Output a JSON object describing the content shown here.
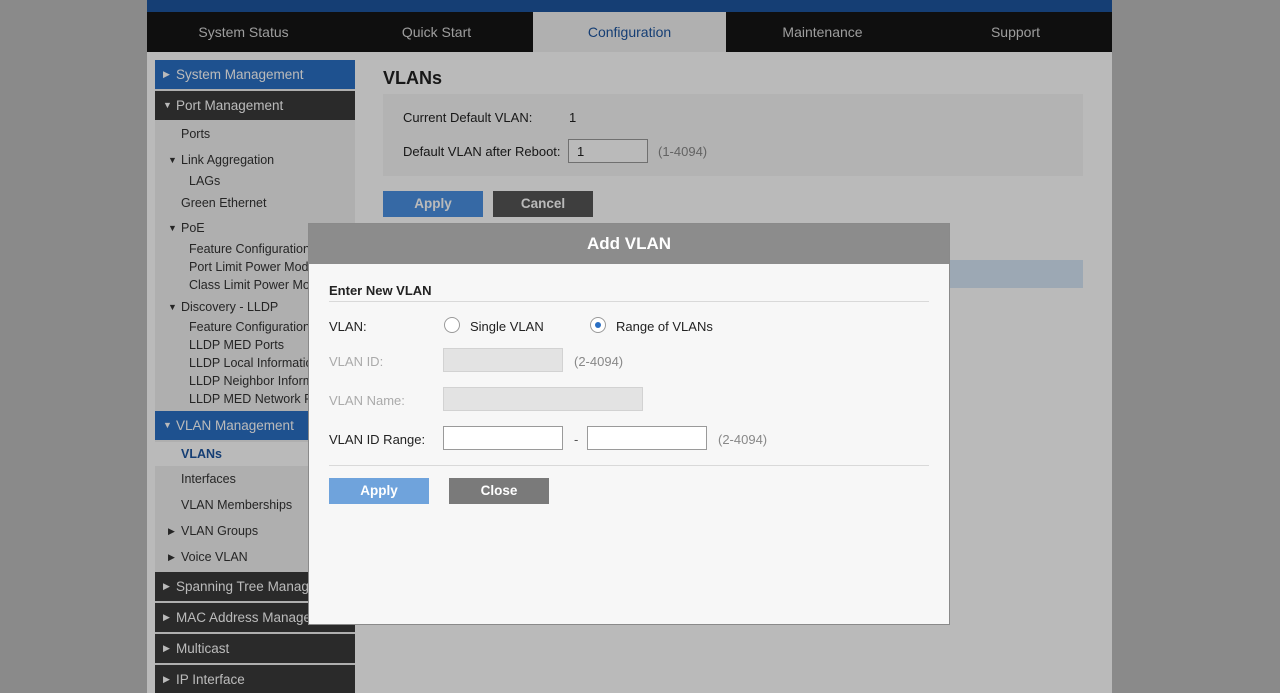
{
  "topnav": {
    "tabs": [
      "System Status",
      "Quick Start",
      "Configuration",
      "Maintenance",
      "Support"
    ],
    "active": "Configuration"
  },
  "sidebar": {
    "system_management": "System Management",
    "port_management": "Port Management",
    "ports": "Ports",
    "link_aggregation": "Link Aggregation",
    "lags": "LAGs",
    "green_ethernet": "Green Ethernet",
    "poe": "PoE",
    "poe_feature_config": "Feature Configuration",
    "port_limit_power_mode": "Port Limit Power Mode",
    "class_limit_power_mode": "Class Limit Power Mode",
    "discovery_lldp": "Discovery - LLDP",
    "lldp_feature_config": "Feature Configuration",
    "lldp_med_ports": "LLDP MED Ports",
    "lldp_local_info": "LLDP Local Information",
    "lldp_neighbor_info": "LLDP Neighbor Information",
    "lldp_med_network_policy": "LLDP MED Network Policy",
    "vlan_management": "VLAN Management",
    "vlans": "VLANs",
    "interfaces": "Interfaces",
    "vlan_memberships": "VLAN Memberships",
    "vlan_groups": "VLAN Groups",
    "voice_vlan": "Voice VLAN",
    "spanning_tree": "Spanning Tree Management",
    "mac_address": "MAC Address Management",
    "multicast": "Multicast",
    "ip_interface": "IP Interface"
  },
  "main": {
    "title": "VLANs",
    "current_default_label": "Current Default VLAN:",
    "current_default_value": "1",
    "after_reboot_label": "Default VLAN after Reboot:",
    "after_reboot_value": "1",
    "after_reboot_hint": "(1-4094)",
    "apply": "Apply",
    "cancel": "Cancel"
  },
  "modal": {
    "title": "Add VLAN",
    "section": "Enter New VLAN",
    "vlan_label": "VLAN:",
    "single_vlan": "Single VLAN",
    "range_of_vlans": "Range of VLANs",
    "selected_mode": "Range of VLANs",
    "vlan_id_label": "VLAN ID:",
    "vlan_id_value": "",
    "vlan_id_hint": "(2-4094)",
    "vlan_name_label": "VLAN Name:",
    "vlan_name_value": "",
    "vlan_id_range_label": "VLAN ID Range:",
    "range_from": "",
    "range_dash": "-",
    "range_to": "",
    "range_hint": "(2-4094)",
    "apply": "Apply",
    "close": "Close"
  },
  "colors": {
    "brand_blue": "#1e56a0",
    "sidebar_active": "#2a6fc4",
    "apply_blue": "#6fa3dc",
    "close_gray": "#7a7a7a",
    "modal_header": "#8c8c8c"
  },
  "icons": {
    "collapsed_arrow": "triangle-right-icon",
    "expanded_arrow": "triangle-down-icon"
  }
}
